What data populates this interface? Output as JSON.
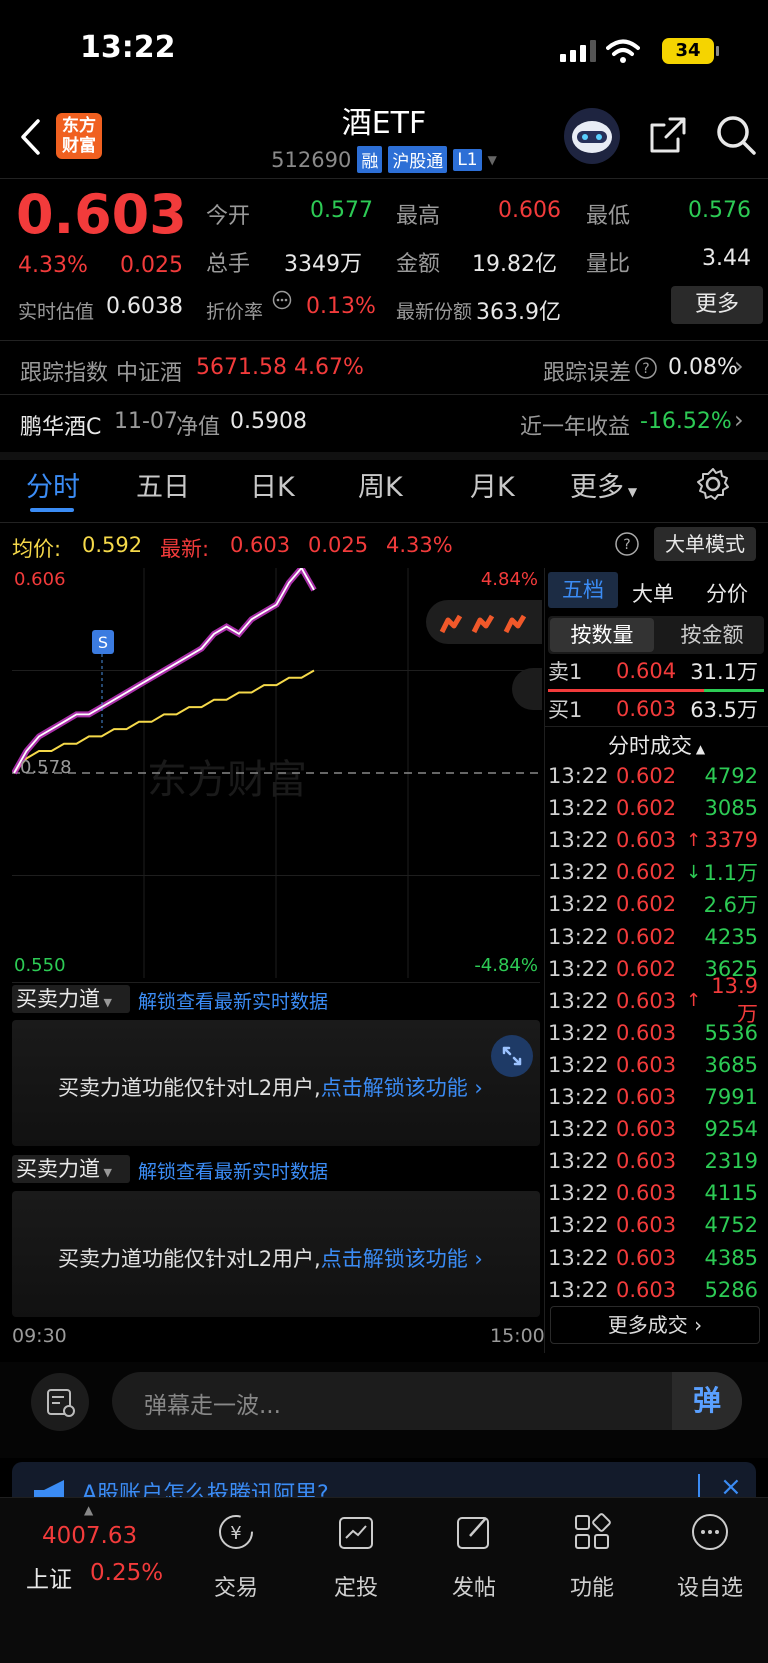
{
  "status_bar": {
    "time": "13:22",
    "battery": "34"
  },
  "header": {
    "title": "酒ETF",
    "code": "512690",
    "tags": [
      "融",
      "沪股通",
      "L1"
    ],
    "logo_text": "东方财富"
  },
  "quote": {
    "price": "0.603",
    "change_pct": "4.33%",
    "change": "0.025",
    "open_label": "今开",
    "open": "0.577",
    "high_label": "最高",
    "high": "0.606",
    "low_label": "最低",
    "low": "0.576",
    "volume_label": "总手",
    "volume": "3349万",
    "amount_label": "金额",
    "amount": "19.82亿",
    "vol_ratio_label": "量比",
    "vol_ratio": "3.44",
    "iopv_label": "实时估值",
    "iopv": "0.6038",
    "premium_label": "折价率",
    "premium": "0.13%",
    "shares_label": "最新份额",
    "shares": "363.9亿",
    "more": "更多"
  },
  "tracking": {
    "label": "跟踪指数",
    "index_name": "中证酒",
    "index_value": "5671.58",
    "index_pct": "4.67%",
    "error_label": "跟踪误差",
    "error": "0.08%"
  },
  "fund": {
    "name": "鹏华酒C",
    "date": "11-07",
    "nav_label": "净值",
    "nav": "0.5908",
    "return_label": "近一年收益",
    "return": "-16.52%"
  },
  "tabs": [
    "分时",
    "五日",
    "日K",
    "周K",
    "月K",
    "更多"
  ],
  "chart_header": {
    "avg_label": "均价:",
    "avg": "0.592",
    "last_label": "最新:",
    "last": "0.603",
    "chg": "0.025",
    "pct": "4.33%",
    "mode_button": "大单模式"
  },
  "chart_data": {
    "type": "line",
    "y_top_label": "0.606",
    "y_mid_label": "0.578",
    "y_bottom_label": "0.550",
    "pct_top": "4.84%",
    "pct_bottom": "-4.84%",
    "x_start": "09:30",
    "x_end": "15:00",
    "ylim": [
      0.55,
      0.606
    ],
    "baseline": 0.578,
    "series": [
      {
        "values": [
          0.578,
          0.581,
          0.583,
          0.584,
          0.585,
          0.586,
          0.586,
          0.587,
          0.588,
          0.589,
          0.59,
          0.591,
          0.592,
          0.593,
          0.594,
          0.595,
          0.597,
          0.598,
          0.597,
          0.599,
          0.6,
          0.601,
          0.604,
          0.606,
          0.603
        ]
      },
      {
        "values": [
          0.578,
          0.58,
          0.581,
          0.581,
          0.582,
          0.582,
          0.583,
          0.583,
          0.584,
          0.584,
          0.585,
          0.585,
          0.586,
          0.586,
          0.587,
          0.587,
          0.588,
          0.588,
          0.589,
          0.589,
          0.59,
          0.59,
          0.591,
          0.591,
          0.592
        ]
      }
    ],
    "marker": "S",
    "watermark": "东方财富"
  },
  "orderbook": {
    "tabs": [
      "五档",
      "大单",
      "分价"
    ],
    "subtabs": [
      "按数量",
      "按金额"
    ],
    "sell_label": "卖1",
    "sell_price": "0.604",
    "sell_vol": "31.1万",
    "buy_label": "买1",
    "buy_price": "0.603",
    "buy_vol": "63.5万",
    "trades_title": "分时成交",
    "trades": [
      {
        "t": "13:22",
        "p": "0.602",
        "a": "",
        "v": "4792",
        "pc": "red",
        "vc": "green"
      },
      {
        "t": "13:22",
        "p": "0.602",
        "a": "",
        "v": "3085",
        "pc": "red",
        "vc": "green"
      },
      {
        "t": "13:22",
        "p": "0.603",
        "a": "↑",
        "v": "3379",
        "pc": "red",
        "vc": "red"
      },
      {
        "t": "13:22",
        "p": "0.602",
        "a": "↓",
        "v": "1.1万",
        "pc": "red",
        "vc": "green"
      },
      {
        "t": "13:22",
        "p": "0.602",
        "a": "",
        "v": "2.6万",
        "pc": "red",
        "vc": "green"
      },
      {
        "t": "13:22",
        "p": "0.602",
        "a": "",
        "v": "4235",
        "pc": "red",
        "vc": "green"
      },
      {
        "t": "13:22",
        "p": "0.602",
        "a": "",
        "v": "3625",
        "pc": "red",
        "vc": "green"
      },
      {
        "t": "13:22",
        "p": "0.603",
        "a": "↑",
        "v": "13.9万",
        "pc": "red",
        "vc": "red"
      },
      {
        "t": "13:22",
        "p": "0.603",
        "a": "",
        "v": "5536",
        "pc": "red",
        "vc": "green"
      },
      {
        "t": "13:22",
        "p": "0.603",
        "a": "",
        "v": "3685",
        "pc": "red",
        "vc": "green"
      },
      {
        "t": "13:22",
        "p": "0.603",
        "a": "",
        "v": "7991",
        "pc": "red",
        "vc": "green"
      },
      {
        "t": "13:22",
        "p": "0.603",
        "a": "",
        "v": "9254",
        "pc": "red",
        "vc": "green"
      },
      {
        "t": "13:22",
        "p": "0.603",
        "a": "",
        "v": "2319",
        "pc": "red",
        "vc": "green"
      },
      {
        "t": "13:22",
        "p": "0.603",
        "a": "",
        "v": "4115",
        "pc": "red",
        "vc": "green"
      },
      {
        "t": "13:22",
        "p": "0.603",
        "a": "",
        "v": "4752",
        "pc": "red",
        "vc": "green"
      },
      {
        "t": "13:22",
        "p": "0.603",
        "a": "",
        "v": "4385",
        "pc": "red",
        "vc": "green"
      },
      {
        "t": "13:22",
        "p": "0.603",
        "a": "",
        "v": "5286",
        "pc": "red",
        "vc": "green"
      }
    ],
    "more_trades": "更多成交"
  },
  "force_panels": [
    {
      "title": "买卖力道",
      "unlock_link": "解锁查看最新实时数据",
      "msg": "买卖力道功能仅针对L2用户,",
      "action": "点击解锁该功能"
    },
    {
      "title": "买卖力道",
      "unlock_link": "解锁查看最新实时数据",
      "msg": "买卖力道功能仅针对L2用户,",
      "action": "点击解锁该功能"
    }
  ],
  "comment": {
    "placeholder": "弹幕走一波...",
    "send": "弹"
  },
  "banner": {
    "text": "A股账户怎么投腾讯阿里?"
  },
  "bottom_nav": {
    "index_value": "4007.63",
    "index_name": "上证",
    "index_pct": "0.25%",
    "items": [
      "交易",
      "定投",
      "发帖",
      "功能",
      "设自选"
    ]
  },
  "colors": {
    "up": "#f23b3b",
    "down": "#2dcb55",
    "accent": "#3b8cf5",
    "avg_line": "#f5d94a",
    "price_line": "#ffffff"
  }
}
